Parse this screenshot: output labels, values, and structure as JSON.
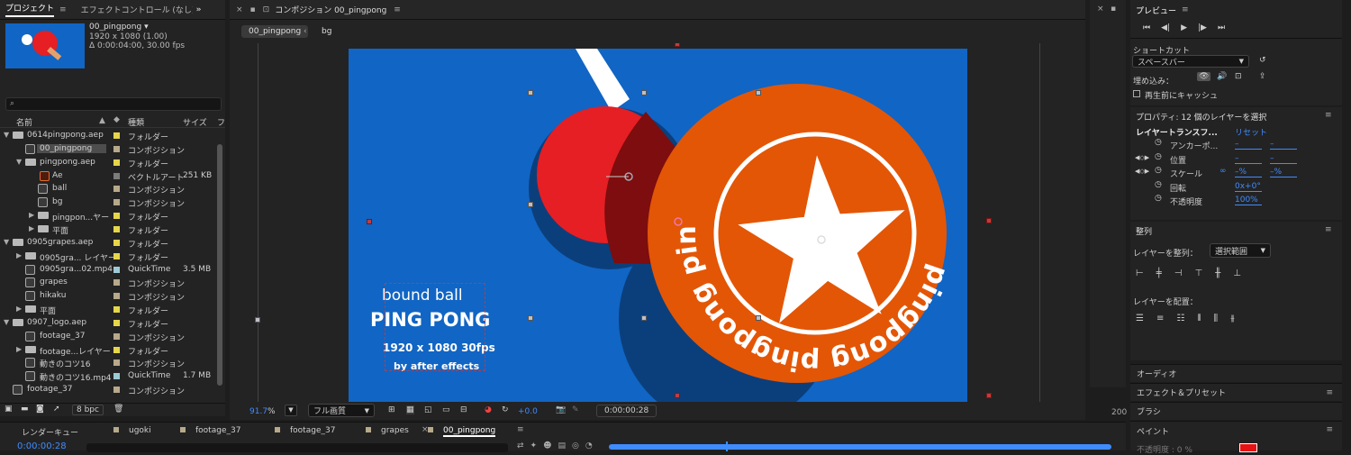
{
  "project": {
    "tab_project": "プロジェクト",
    "tab_effects": "エフェクトコントロール (なし)",
    "item_name": "00_pingpong ▾",
    "item_res": "1920 x 1080 (1.00)",
    "item_dur": "Δ 0:00:04:00, 30.00 fps",
    "search_placeholder": "",
    "col_name": "名前",
    "col_type": "種類",
    "col_size": "サイズ",
    "col_f": "フ",
    "rows": [
      {
        "name": "0614pingpong.aep",
        "type": "フォルダー",
        "size": ""
      },
      {
        "name": "00_pingpong",
        "type": "コンポジション",
        "size": ""
      },
      {
        "name": "pingpong.aep",
        "type": "フォルダー",
        "size": ""
      },
      {
        "name": "Ae",
        "type": "ベクトルアート",
        "size": "251 KB"
      },
      {
        "name": "ball",
        "type": "コンポジション",
        "size": ""
      },
      {
        "name": "bg",
        "type": "コンポジション",
        "size": ""
      },
      {
        "name": "pingpon...ヤー",
        "type": "フォルダー",
        "size": ""
      },
      {
        "name": "平面",
        "type": "フォルダー",
        "size": ""
      },
      {
        "name": "0905grapes.aep",
        "type": "フォルダー",
        "size": ""
      },
      {
        "name": "0905gra... レイヤー",
        "type": "フォルダー",
        "size": ""
      },
      {
        "name": "0905gra...02.mp4",
        "type": "QuickTime",
        "size": "3.5 MB"
      },
      {
        "name": "grapes",
        "type": "コンポジション",
        "size": ""
      },
      {
        "name": "hikaku",
        "type": "コンポジション",
        "size": ""
      },
      {
        "name": "平面",
        "type": "フォルダー",
        "size": ""
      },
      {
        "name": "0907_logo.aep",
        "type": "フォルダー",
        "size": ""
      },
      {
        "name": "footage_37",
        "type": "コンポジション",
        "size": ""
      },
      {
        "name": "footage...レイヤー",
        "type": "フォルダー",
        "size": ""
      },
      {
        "name": "動きのコツ16",
        "type": "コンポジション",
        "size": ""
      },
      {
        "name": "動きのコツ16.mp4",
        "type": "QuickTime",
        "size": "1.7 MB"
      },
      {
        "name": "footage_37",
        "type": "コンポジション",
        "size": ""
      }
    ],
    "bpc": "8 bpc"
  },
  "composition": {
    "panel_title": "コンポジション 00_pingpong",
    "flow_active": "00_pingpong",
    "flow_next": "bg",
    "zoom": "91.7",
    "zoom_unit": "%",
    "quality": "フル画質",
    "exposure": "+0.0",
    "timecode": "0:00:00:28",
    "canvas_text": {
      "subtitle": "bound ball",
      "title": "PING PONG",
      "spec": "1920 x 1080 30fps",
      "credit": "by after effects",
      "ring_word": "pingpong"
    }
  },
  "right": {
    "preview_title": "プレビュー",
    "shortcut_label": "ショートカット",
    "shortcut_value": "スペースバー",
    "embed_label": "埋め込み：",
    "cache_label": "再生前にキャッシュ",
    "props_title": "プロパティ: 12 個のレイヤーを選択",
    "transform_label": "レイヤートランスフ...",
    "reset_label": "リセット",
    "props": [
      {
        "name": "アンカーポ...",
        "v1": "–",
        "v2": "–"
      },
      {
        "name": "位置",
        "v1": "–",
        "v2": "–"
      },
      {
        "name": "スケール",
        "v1": "–%",
        "v2": "–%"
      },
      {
        "name": "回転",
        "v1": "0x+0°",
        "v2": ""
      },
      {
        "name": "不透明度",
        "v1": "100%",
        "v2": ""
      }
    ],
    "align_title": "整列",
    "align_to_label": "レイヤーを整列：",
    "align_to_value": "選択範囲",
    "distribute_label": "レイヤーを配置：",
    "audio": "オーディオ",
    "effects": "エフェクト＆プリセット",
    "brush": "ブラシ",
    "paint": "ペイント",
    "paint_sub": "不透明度 : 0 %",
    "zoom_partial": "200"
  },
  "timeline": {
    "tabs": [
      "レンダーキュー",
      "ugoki",
      "footage_37",
      "footage_37",
      "grapes",
      "00_pingpong"
    ],
    "timecode": "0:00:00:28"
  },
  "colors": {
    "comp_bg": "#1165c4",
    "paddle_red": "#e51f24",
    "ball_orange": "#e35606",
    "accent_blue": "#3f8cff",
    "paint_red": "#e51313"
  }
}
